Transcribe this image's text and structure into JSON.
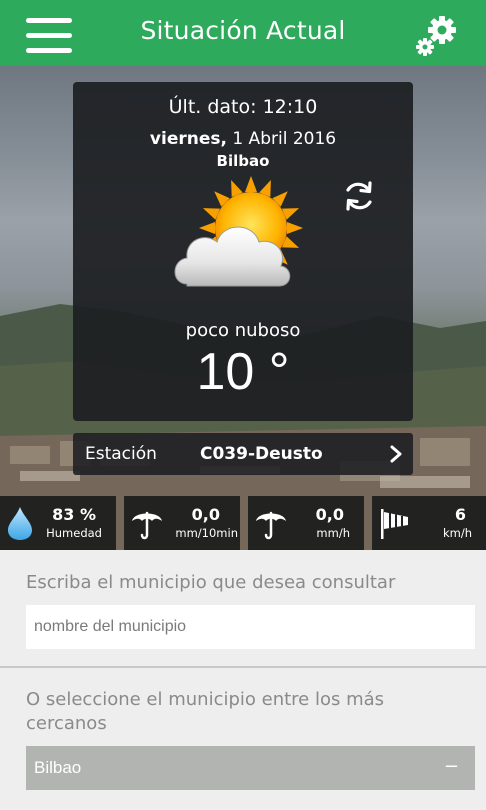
{
  "header": {
    "title": "Situación Actual",
    "menu_icon": "hamburger-menu-icon",
    "settings_icon": "gears-icon"
  },
  "weather": {
    "last_update": "Últ. dato: 12:10",
    "date_day": "viernes,",
    "date_rest": " 1 Abril 2016",
    "city": "Bilbao",
    "condition": "poco nuboso",
    "temperature": "10 °",
    "icon": "partly-cloudy-sun-icon"
  },
  "station": {
    "label": "Estación",
    "value": "C039-Deusto"
  },
  "stats": [
    {
      "value": "83 %",
      "unit": "Humedad",
      "icon": "water-drop-icon"
    },
    {
      "value": "0,0",
      "unit": "mm/10min",
      "icon": "umbrella-icon"
    },
    {
      "value": "0,0",
      "unit": "mm/h",
      "icon": "umbrella-icon"
    },
    {
      "value": "6",
      "unit": "km/h",
      "icon": "windsock-icon"
    }
  ],
  "search": {
    "title": "Escriba el municipio que desea consultar",
    "placeholder": "nombre del municipio"
  },
  "nearby": {
    "title": "O seleccione el municipio entre los más cercanos",
    "selected": "Bilbao",
    "indicator": "−"
  },
  "colors": {
    "header": "#2eaa5c",
    "card": "#1c1e22",
    "select": "#b2b4b1"
  }
}
